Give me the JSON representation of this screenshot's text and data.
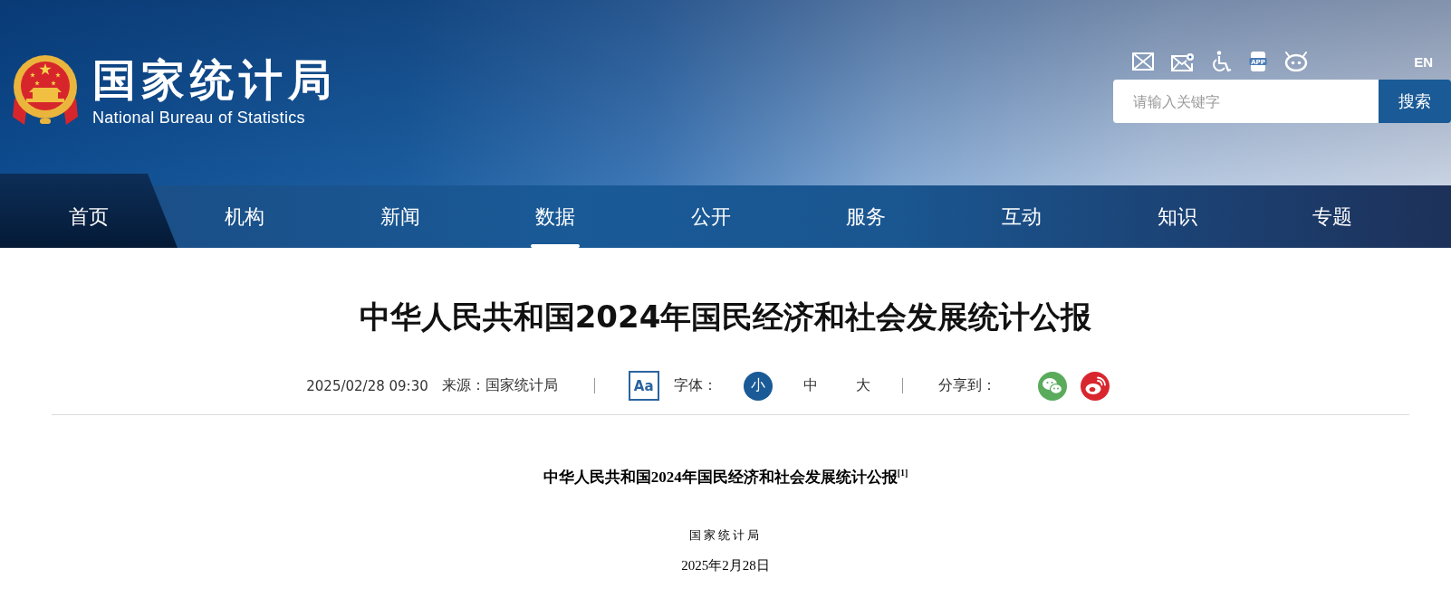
{
  "header": {
    "logo_title": "国家统计局",
    "logo_subtitle": "National Bureau of Statistics",
    "app_icon_label": "APP",
    "language": "EN",
    "search": {
      "placeholder": "请输入关键字",
      "button": "搜索"
    }
  },
  "nav": [
    {
      "label": "首页",
      "kind": "home",
      "selected": false
    },
    {
      "label": "机构",
      "kind": "section",
      "selected": false
    },
    {
      "label": "新闻",
      "kind": "section",
      "selected": false
    },
    {
      "label": "数据",
      "kind": "section",
      "selected": true
    },
    {
      "label": "公开",
      "kind": "section",
      "selected": false
    },
    {
      "label": "服务",
      "kind": "section",
      "selected": false
    },
    {
      "label": "互动",
      "kind": "section",
      "selected": false
    },
    {
      "label": "知识",
      "kind": "section",
      "selected": false
    },
    {
      "label": "专题",
      "kind": "section",
      "selected": false
    }
  ],
  "article": {
    "title": "中华人民共和国2024年国民经济和社会发展统计公报",
    "date": "2025/02/28 09:30",
    "source": "来源：国家统计局",
    "font_badge": "Aa",
    "font_label": "字体：",
    "font_sizes": [
      {
        "label": "小",
        "selected": true
      },
      {
        "label": "中",
        "selected": false
      },
      {
        "label": "大",
        "selected": false
      }
    ],
    "share_label": "分享到："
  },
  "body": {
    "title": "中华人民共和国2024年国民经济和社会发展统计公报$^{[1]}$",
    "issuer": "国家统计局",
    "date": "2025年2月28日"
  }
}
